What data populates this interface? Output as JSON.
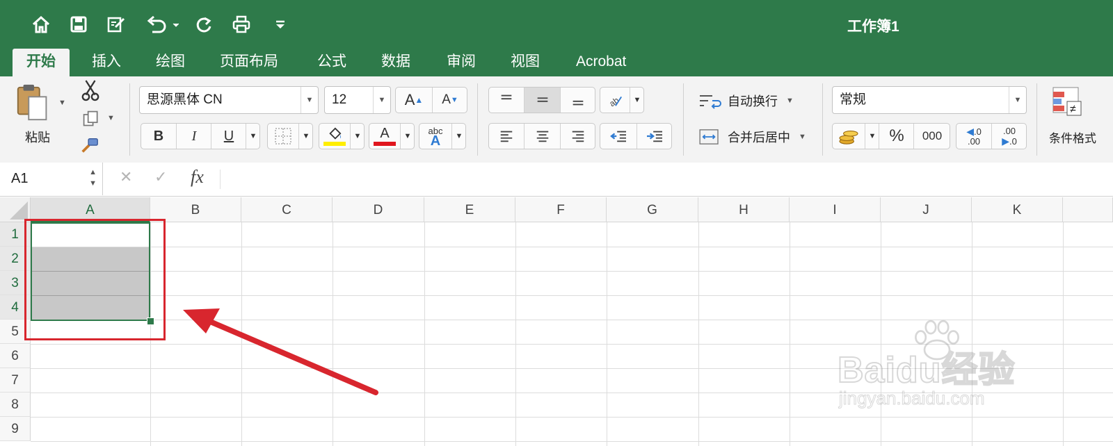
{
  "window": {
    "title": "工作簿1"
  },
  "quick_access": [
    {
      "name": "home-icon"
    },
    {
      "name": "save-icon"
    },
    {
      "name": "edit-document-icon"
    },
    {
      "name": "undo-icon"
    },
    {
      "name": "redo-icon"
    },
    {
      "name": "print-icon"
    },
    {
      "name": "customize-toolbar-icon"
    }
  ],
  "tabs": [
    "开始",
    "插入",
    "绘图",
    "页面布局",
    "公式",
    "数据",
    "审阅",
    "视图",
    "Acrobat"
  ],
  "active_tab": "开始",
  "ribbon": {
    "paste_label": "粘贴",
    "font_name": "思源黑体 CN",
    "font_size": "12",
    "bold": "B",
    "italic": "I",
    "underline": "U",
    "wrap_text": "自动换行",
    "merge_center": "合并后居中",
    "number_format": "常规",
    "percent": "%",
    "thousands": "000",
    "increase_decimal_top": ".0",
    "increase_decimal_bottom": ".00",
    "decrease_decimal_top": ".00",
    "decrease_decimal_bottom": ".0",
    "font_color_text": "A",
    "grow_font": "A",
    "shrink_font": "A",
    "abc": "abc",
    "conditional_format": "条件格式"
  },
  "formula_bar": {
    "name_box": "A1",
    "cancel": "✕",
    "enter": "✓",
    "fx": "fx",
    "value": ""
  },
  "sheet": {
    "columns": [
      "A",
      "B",
      "C",
      "D",
      "E",
      "F",
      "G",
      "H",
      "I",
      "J",
      "K"
    ],
    "rows": [
      "1",
      "2",
      "3",
      "4",
      "5",
      "6",
      "7",
      "8",
      "9"
    ],
    "active_cell": "A1",
    "selection": "A1:A4"
  },
  "colors": {
    "accent": "#2e7a4a",
    "annotation": "#d8262e",
    "selection_fill": "#c8c8c8"
  },
  "watermark": {
    "brand": "Baidu经验",
    "url": "jingyan.baidu.com"
  }
}
